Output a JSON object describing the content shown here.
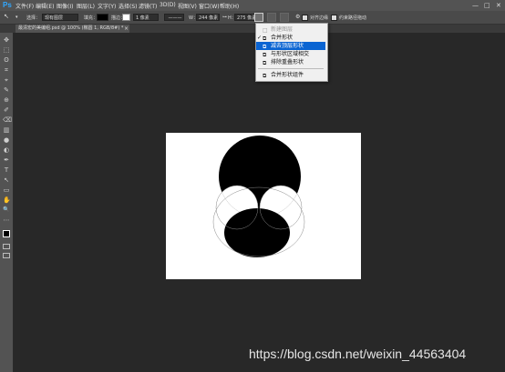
{
  "app": {
    "logo": "Ps"
  },
  "menubar": {
    "items": [
      "文件(F)",
      "编辑(E)",
      "图像(I)",
      "图层(L)",
      "文字(Y)",
      "选择(S)",
      "滤镜(T)",
      "3D(D)",
      "视图(V)",
      "窗口(W)",
      "帮助(H)"
    ]
  },
  "window_controls": {
    "minimize": "—",
    "maximize": "□",
    "close": "✕"
  },
  "options": {
    "pick_label": "选择：",
    "pick_value": "现有图层",
    "fill_label": "填充：",
    "stroke_label": "描边：",
    "stroke_width": "1 像素",
    "w_label": "W：",
    "w_value": "244 像素",
    "h_label": "H：",
    "h_value": "275 像素",
    "align_edges": "对齐边缘",
    "constrain_paths": "约束路径拖动"
  },
  "document_tab": {
    "title": "最清宏的美编组.psd @ 100% (椭圆 1, RGB/8#) *",
    "close": "×"
  },
  "dropdown": {
    "items": [
      {
        "label": "新建图层",
        "checked": false,
        "disabled": true,
        "selected": false
      },
      {
        "label": "合并形状",
        "checked": true,
        "disabled": false,
        "selected": false
      },
      {
        "label": "减去顶层形状",
        "checked": false,
        "disabled": false,
        "selected": true
      },
      {
        "label": "与形状区域相交",
        "checked": false,
        "disabled": false,
        "selected": false
      },
      {
        "label": "排除重叠形状",
        "checked": false,
        "disabled": false,
        "selected": false
      },
      {
        "label": "合并形状组件",
        "checked": false,
        "disabled": false,
        "selected": false
      }
    ],
    "check_mark": "✓"
  },
  "tools": [
    "✥",
    "⬚",
    "ʘ",
    "⌗",
    "⌖",
    "✎",
    "⊕",
    "✐",
    "⌫",
    "▥",
    "●",
    "◐",
    "✒",
    "T",
    "↖",
    "▭",
    "✋",
    "🔍",
    "⋯"
  ],
  "colors": {
    "accent": "#0a64d2",
    "canvas": "#ffffff",
    "shape": "#000000",
    "workspace": "#282828"
  },
  "watermark": "https://blog.csdn.net/weixin_44563404"
}
